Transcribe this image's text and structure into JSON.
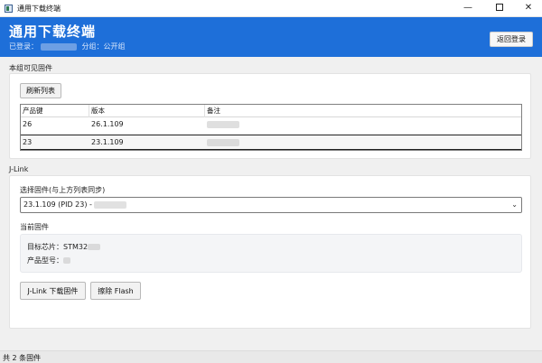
{
  "window": {
    "title": "通用下载终端",
    "minimize": "—",
    "close": "✕"
  },
  "header": {
    "title": "通用下载终端",
    "logged_in_label": "已登录：",
    "group_label": "分组：公开组",
    "logout_button": "返回登录",
    "accent_color": "#1e6fd9"
  },
  "firmware_section": {
    "title": "本组可见固件",
    "refresh_button": "刷新列表",
    "columns": [
      "产品键",
      "版本",
      "备注"
    ],
    "rows": [
      {
        "key": "26",
        "version": "26.1.109"
      },
      {
        "key": "23",
        "version": "23.1.109"
      }
    ]
  },
  "jlink_section": {
    "title": "J-Link",
    "select_label": "选择固件(与上方列表同步)",
    "select_value": "23.1.109 (PID 23) - ",
    "current_label": "当前固件",
    "chip_label": "目标芯片：STM32",
    "model_label": "产品型号：",
    "download_button": "J-Link 下载固件",
    "erase_button": "擦除 Flash"
  },
  "statusbar": {
    "text": "共 2 条固件"
  }
}
